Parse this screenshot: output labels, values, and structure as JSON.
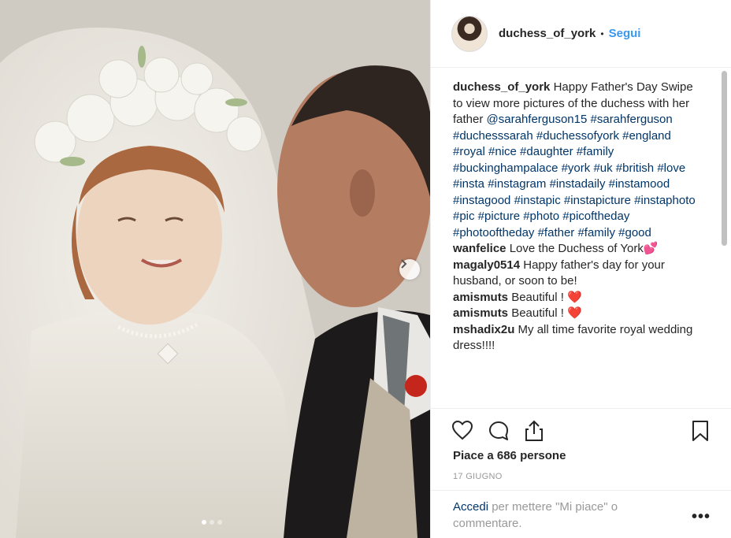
{
  "post": {
    "username": "duchess_of_york",
    "separator": "•",
    "follow_label": "Segui",
    "comments": [
      {
        "user": "duchess_of_york",
        "text": "Happy Father's Day Swipe to view more pictures of the duchess with her father",
        "tags": "@sarahferguson15 #sarahferguson #duchesssarah #duchessofyork #england #royal #nice #daughter #family #buckinghampalace #york #uk #british #love #insta #instagram #instadaily #instamood #instagood #instapic #instapicture #instaphoto #pic #picture #photo #picoftheday #photooftheday #father #family #good"
      },
      {
        "user": "wanfelice",
        "text": "Love the Duchess of York💕",
        "tags": ""
      },
      {
        "user": "magaly0514",
        "text": "Happy father's day for your husband, or soon to be!",
        "tags": ""
      },
      {
        "user": "amismuts",
        "text": "Beautiful ! ❤️",
        "tags": ""
      },
      {
        "user": "amismuts",
        "text": "Beautiful ! ❤️",
        "tags": ""
      },
      {
        "user": "mshadix2u",
        "text": "My all time favorite royal wedding dress!!!!",
        "tags": ""
      }
    ],
    "likes": "Piace a 686 persone",
    "date": "17 GIUGNO",
    "login_link": "Accedi",
    "login_text": "per mettere \"Mi piace\" o commentare.",
    "more_label": "•••",
    "icons": [
      "heart-icon",
      "comment-icon",
      "share-icon",
      "bookmark-icon",
      "chevron-right-icon"
    ]
  }
}
